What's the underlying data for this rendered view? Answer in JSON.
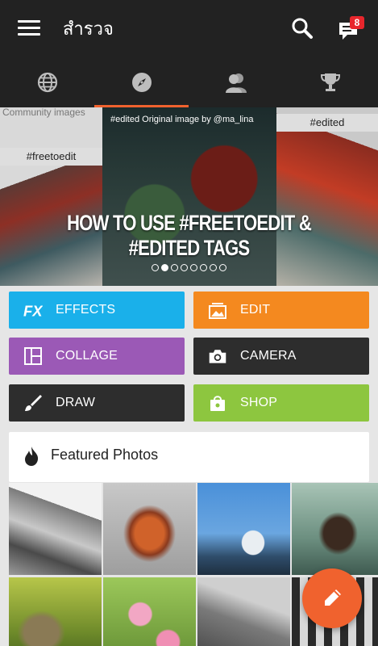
{
  "app": {
    "title": "สำรวจ"
  },
  "header": {
    "notification_count": "8"
  },
  "tabs": [
    {
      "name": "globe-icon",
      "active": false
    },
    {
      "name": "compass-icon",
      "active": true
    },
    {
      "name": "people-icon",
      "active": false
    },
    {
      "name": "trophy-icon",
      "active": false
    }
  ],
  "banner": {
    "caption_community": "Community images",
    "tag_free": "#freetoedit",
    "caption_original": "#edited Original image by @ma_lina",
    "tag_edited": "#edited",
    "headline": "HOW TO USE #FREETOEDIT & #EDITED TAGS",
    "slide_count": 8,
    "active_slide": 1
  },
  "actions": {
    "effects": "EFFECTS",
    "edit": "EDIT",
    "collage": "COLLAGE",
    "camera": "CAMERA",
    "draw": "DRAW",
    "shop": "SHOP"
  },
  "colors": {
    "effects": "#1ab0ea",
    "edit": "#f4891f",
    "collage": "#9b59b6",
    "camera": "#2d2d2d",
    "draw": "#2d2d2d",
    "shop": "#8dc63f",
    "accent": "#f0622e",
    "bar": "#222222"
  },
  "featured": {
    "title": "Featured Photos"
  }
}
